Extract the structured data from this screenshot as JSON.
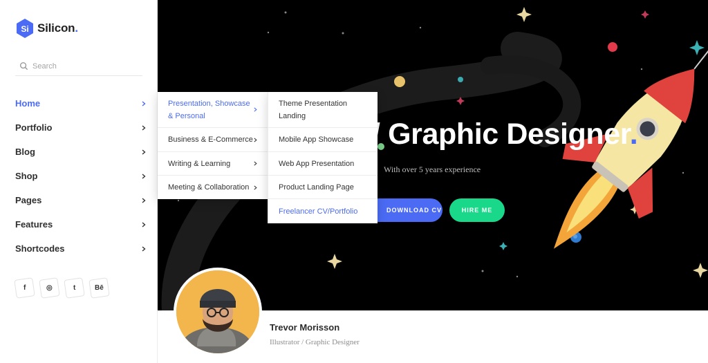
{
  "brand": {
    "name": "Silicon",
    "accent": "#4b6bf5"
  },
  "search": {
    "placeholder": "Search"
  },
  "nav": {
    "items": [
      {
        "label": "Home",
        "active": true
      },
      {
        "label": "Portfolio"
      },
      {
        "label": "Blog"
      },
      {
        "label": "Shop"
      },
      {
        "label": "Pages"
      },
      {
        "label": "Features"
      },
      {
        "label": "Shortcodes"
      }
    ]
  },
  "social": [
    {
      "icon": "facebook-icon",
      "glyph": "f"
    },
    {
      "icon": "dribbble-icon",
      "glyph": "◎"
    },
    {
      "icon": "twitter-icon",
      "glyph": "t"
    },
    {
      "icon": "behance-icon",
      "glyph": "Bē"
    }
  ],
  "menu1": {
    "items": [
      {
        "label": "Presentation, Showcase & Personal",
        "active": true
      },
      {
        "label": "Business & E-Commerce"
      },
      {
        "label": "Writing & Learning"
      },
      {
        "label": "Meeting & Collaboration"
      }
    ]
  },
  "menu2": {
    "items": [
      {
        "label": "Theme Presentation Landing"
      },
      {
        "label": "Mobile App Showcase"
      },
      {
        "label": "Web App Presentation"
      },
      {
        "label": "Product Landing Page"
      },
      {
        "label": "Freelancer CV/Portfolio",
        "active": true
      }
    ]
  },
  "hero": {
    "title": "/ Graphic Designer",
    "title_dot": ".",
    "subtitle": "With over 5 years experience",
    "download_label": "DOWNLOAD CV",
    "hire_label": "HIRE ME",
    "colors": {
      "download": "#4b6bf5",
      "hire": "#19d88a"
    }
  },
  "profile": {
    "name": "Trevor Morisson",
    "role": "Illustrator / Graphic Designer"
  }
}
